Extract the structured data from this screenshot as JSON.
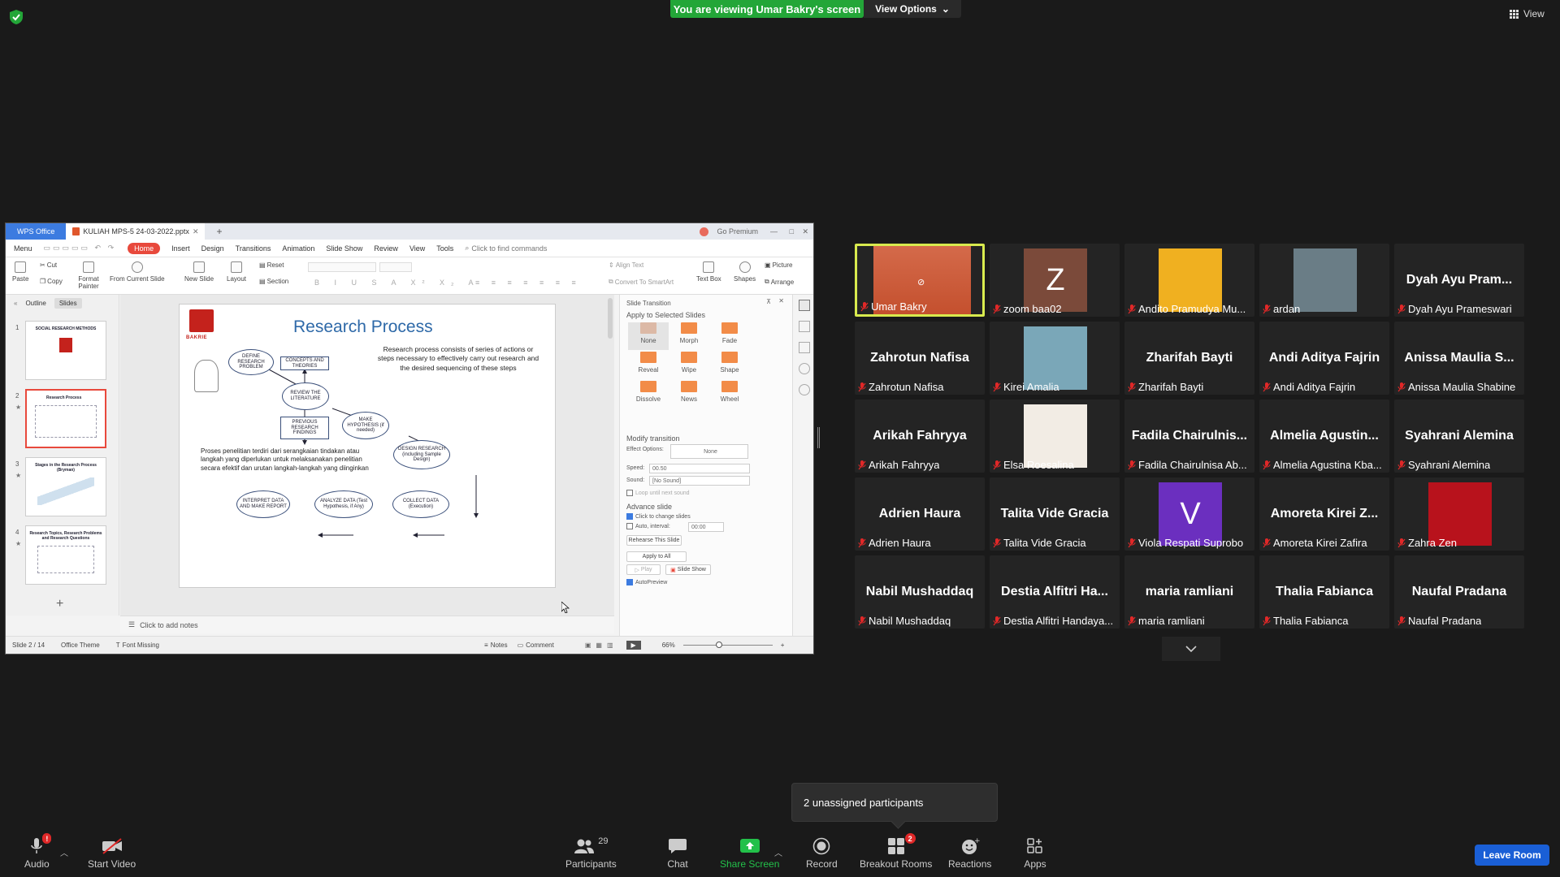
{
  "top": {
    "banner": "You are viewing Umar Bakry's screen",
    "view_options": "View Options",
    "view": "View"
  },
  "wps": {
    "brand_tab": "WPS Office",
    "doc_tab": "KULIAH MPS-5 24-03-2022.pptx",
    "go_premium": "Go Premium",
    "menu": [
      "Menu",
      "Home",
      "Insert",
      "Design",
      "Transitions",
      "Animation",
      "Slide Show",
      "Review",
      "View",
      "Tools"
    ],
    "search_placeholder": "Click to find commands",
    "ribbon": {
      "paste": "Paste",
      "cut": "Cut",
      "copy": "Copy",
      "format_painter": "Format Painter",
      "from_current_slide": "From Current Slide",
      "new_slide": "New Slide",
      "layout": "Layout",
      "reset": "Reset",
      "section": "Section",
      "align_text": "Align Text",
      "convert_smartart": "Convert To SmartArt",
      "text_box": "Text Box",
      "shapes": "Shapes",
      "picture": "Picture",
      "arrange": "Arrange"
    },
    "left_tabs": [
      "Outline",
      "Slides"
    ],
    "thumbs": [
      {
        "num": "1",
        "title": "SOCIAL RESEARCH METHODS"
      },
      {
        "num": "2",
        "title": "Research Process"
      },
      {
        "num": "3",
        "title": "Stages in the Research Process (Bryman)"
      },
      {
        "num": "4",
        "title": "Research Topics, Research Problems and Research Questions"
      }
    ],
    "slide": {
      "title": "Research Process",
      "logo_text": "BAKRIE",
      "desc_en": "Research process consists of series of actions or steps necessary to effectively carry out research and the desired sequencing of these steps",
      "desc_id": "Proses penelitian terdiri dari serangkaian tindakan atau langkah yang diperlukan untuk melaksanakan penelitian secara efektif dan urutan langkah-langkah yang diinginkan",
      "nodes": {
        "define": "DEFINE RESEARCH PROBLEM",
        "concepts": "CONCEPTS AND THEORIES",
        "review": "REVIEW THE LITERATURE",
        "previous": "PREVIOUS RESEARCH FINDINGS",
        "hypothesis": "MAKE HYPOTHESIS (if needed)",
        "design": "DESIGN RESEARCH (including Sample Design)",
        "collect": "COLLECT DATA (Execution)",
        "analyze": "ANALYZE DATA (Test Hypothesis, if Any)",
        "interpret": "INTERPRET DATA AND MAKE REPORT"
      }
    },
    "notes": "Click to add notes",
    "pane": {
      "title": "Slide Transition",
      "apply_selected": "Apply to Selected Slides",
      "transitions": [
        "None",
        "Morph",
        "Fade",
        "Reveal",
        "Wipe",
        "Shape",
        "Dissolve",
        "News",
        "Wheel"
      ],
      "modify": "Modify transition",
      "effect_options_label": "Effect Options:",
      "effect_options_value": "None",
      "speed_label": "Speed:",
      "speed_value": "00.50",
      "sound_label": "Sound:",
      "sound_value": "[No Sound]",
      "loop": "Loop until next sound",
      "advance": "Advance slide",
      "click_change": "Click to change slides",
      "auto_interval": "Auto, interval:",
      "interval_value": "00:00",
      "rehearse": "Rehearse This Slide",
      "apply_all": "Apply to All",
      "play": "Play",
      "slide_show": "Slide Show",
      "autopreview": "AutoPreview"
    },
    "status": {
      "slide": "Slide 2 / 14",
      "theme": "Office Theme",
      "font_missing": "Font Missing",
      "notes": "Notes",
      "comment": "Comment",
      "zoom": "66%"
    }
  },
  "participants": [
    {
      "label": "Umar Bakry",
      "type": "video",
      "active": true
    },
    {
      "label": "zoom baa02",
      "type": "letter",
      "letter": "Z",
      "color": "#7b4a3a"
    },
    {
      "label": "Andito Pramudya Mu...",
      "type": "photo",
      "color": "#f0b020"
    },
    {
      "label": "ardan",
      "type": "photo",
      "color": "#6a7d86"
    },
    {
      "label": "Dyah Ayu Prameswari",
      "name": "Dyah Ayu Pram...",
      "type": "name"
    },
    {
      "label": "Zahrotun Nafisa",
      "name": "Zahrotun Nafisa",
      "type": "name"
    },
    {
      "label": "Kirei Amalia",
      "type": "photo",
      "color": "#7aa7b8"
    },
    {
      "label": "Zharifah Bayti",
      "name": "Zharifah Bayti",
      "type": "name"
    },
    {
      "label": "Andi Aditya Fajrin",
      "name": "Andi Aditya Fajrin",
      "type": "name"
    },
    {
      "label": "Anissa Maulia Shabine",
      "name": "Anissa Maulia S...",
      "type": "name"
    },
    {
      "label": "Arikah Fahryya",
      "name": "Arikah Fahryya",
      "type": "name"
    },
    {
      "label": "Elsa Roesalina",
      "type": "photo",
      "color": "#f2ece4"
    },
    {
      "label": "Fadila Chairulnisa Ab...",
      "name": "Fadila  Chairulnis...",
      "type": "name"
    },
    {
      "label": "Almelia Agustina Kba...",
      "name": "Almelia  Agustin...",
      "type": "name"
    },
    {
      "label": "Syahrani Alemina",
      "name": "Syahrani Alemina",
      "type": "name"
    },
    {
      "label": "Adrien Haura",
      "name": "Adrien Haura",
      "type": "name"
    },
    {
      "label": "Talita Vide Gracia",
      "name": "Talita Vide Gracia",
      "type": "name"
    },
    {
      "label": "Viola Respati Suprobo",
      "type": "letter",
      "letter": "V",
      "color": "#6b2fbf"
    },
    {
      "label": "Amoreta Kirei Zafira",
      "name": "Amoreta Kirei Z...",
      "type": "name"
    },
    {
      "label": "Zahra Zen",
      "type": "photo",
      "color": "#b8121c"
    },
    {
      "label": "Nabil Mushaddaq",
      "name": "Nabil Mushaddaq",
      "type": "name"
    },
    {
      "label": "Destia Alfitri Handaya...",
      "name": "Destia  Alfitri Ha...",
      "type": "name"
    },
    {
      "label": "maria ramliani",
      "name": "maria ramliani",
      "type": "name"
    },
    {
      "label": "Thalia Fabianca",
      "name": "Thalia Fabianca",
      "type": "name"
    },
    {
      "label": "Naufal Pradana",
      "name": "Naufal Pradana",
      "type": "name"
    }
  ],
  "tooltip": "2 unassigned participants",
  "toolbar": {
    "audio": "Audio",
    "audio_badge": "!",
    "start_video": "Start Video",
    "participants": "Participants",
    "participants_count": "29",
    "chat": "Chat",
    "share_screen": "Share Screen",
    "record": "Record",
    "breakout_rooms": "Breakout Rooms",
    "breakout_badge": "2",
    "reactions": "Reactions",
    "apps": "Apps",
    "leave_room": "Leave Room"
  },
  "colors": {
    "banner_green": "#23a638",
    "active_speaker": "#d8ea4e",
    "share_green": "#23c04a",
    "leave_blue": "#1a5fd6",
    "wps_red": "#e8493c"
  }
}
